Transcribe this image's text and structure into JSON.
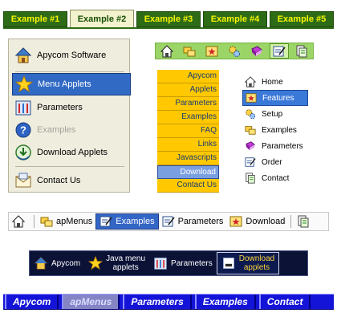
{
  "tabs": [
    {
      "label": "Example #1"
    },
    {
      "label": "Example #2"
    },
    {
      "label": "Example #3"
    },
    {
      "label": "Example #4"
    },
    {
      "label": "Example #5"
    }
  ],
  "vertical_menu": {
    "items": [
      {
        "label": "Apycom Software",
        "icon": "house-icon"
      },
      {
        "label": "Menu Applets",
        "icon": "star-icon"
      },
      {
        "label": "Parameters",
        "icon": "parameters-icon"
      },
      {
        "label": "Examples",
        "icon": "help-icon"
      },
      {
        "label": "Download Applets",
        "icon": "download-icon"
      },
      {
        "label": "Contact Us",
        "icon": "mail-icon"
      }
    ]
  },
  "icon_toolbar": {
    "icons": [
      "house-icon",
      "folders-icon",
      "star-box-icon",
      "gears-icon",
      "book-icon",
      "note-edit-icon",
      "document-icon"
    ]
  },
  "yellow_menu": {
    "items": [
      {
        "label": "Apycom"
      },
      {
        "label": "Applets"
      },
      {
        "label": "Parameters"
      },
      {
        "label": "Examples"
      },
      {
        "label": "FAQ"
      },
      {
        "label": "Links"
      },
      {
        "label": "Javascripts"
      },
      {
        "label": "Download"
      },
      {
        "label": "Contact Us"
      }
    ]
  },
  "icon_list": {
    "items": [
      {
        "label": "Home",
        "icon": "house-icon"
      },
      {
        "label": "Features",
        "icon": "star-box-icon"
      },
      {
        "label": "Setup",
        "icon": "gears-icon"
      },
      {
        "label": "Examples",
        "icon": "folders-icon"
      },
      {
        "label": "Parameters",
        "icon": "book-icon"
      },
      {
        "label": "Order",
        "icon": "note-edit-icon"
      },
      {
        "label": "Contact",
        "icon": "document-icon"
      }
    ]
  },
  "horizontal_toolbar": {
    "items": [
      {
        "label": "apMenus",
        "icon": "folders-icon"
      },
      {
        "label": "Examples",
        "icon": "note-edit-icon"
      },
      {
        "label": "Parameters",
        "icon": "note-edit-icon"
      },
      {
        "label": "Download",
        "icon": "star-box-icon"
      }
    ]
  },
  "dark_toolbar": {
    "items": [
      {
        "label": "Apycom",
        "icon": "house-icon"
      },
      {
        "label": "Java menu",
        "label2": "applets",
        "icon": "star-icon"
      },
      {
        "label": "Parameters",
        "icon": "parameters-icon"
      },
      {
        "label": "Download",
        "label2": "applets",
        "icon": "download-box-icon"
      }
    ]
  },
  "blue_tabs": {
    "items": [
      {
        "label": "Apycom"
      },
      {
        "label": "apMenus"
      },
      {
        "label": "Parameters"
      },
      {
        "label": "Examples"
      },
      {
        "label": "Contact"
      }
    ]
  },
  "colors": {
    "tab_green": "#2e6b17",
    "tab_text": "#f7f700",
    "menu_selected": "#316ac5",
    "yellow": "#ffc800",
    "dark_bar": "#0b1236",
    "blue_bar": "#1414d8"
  }
}
